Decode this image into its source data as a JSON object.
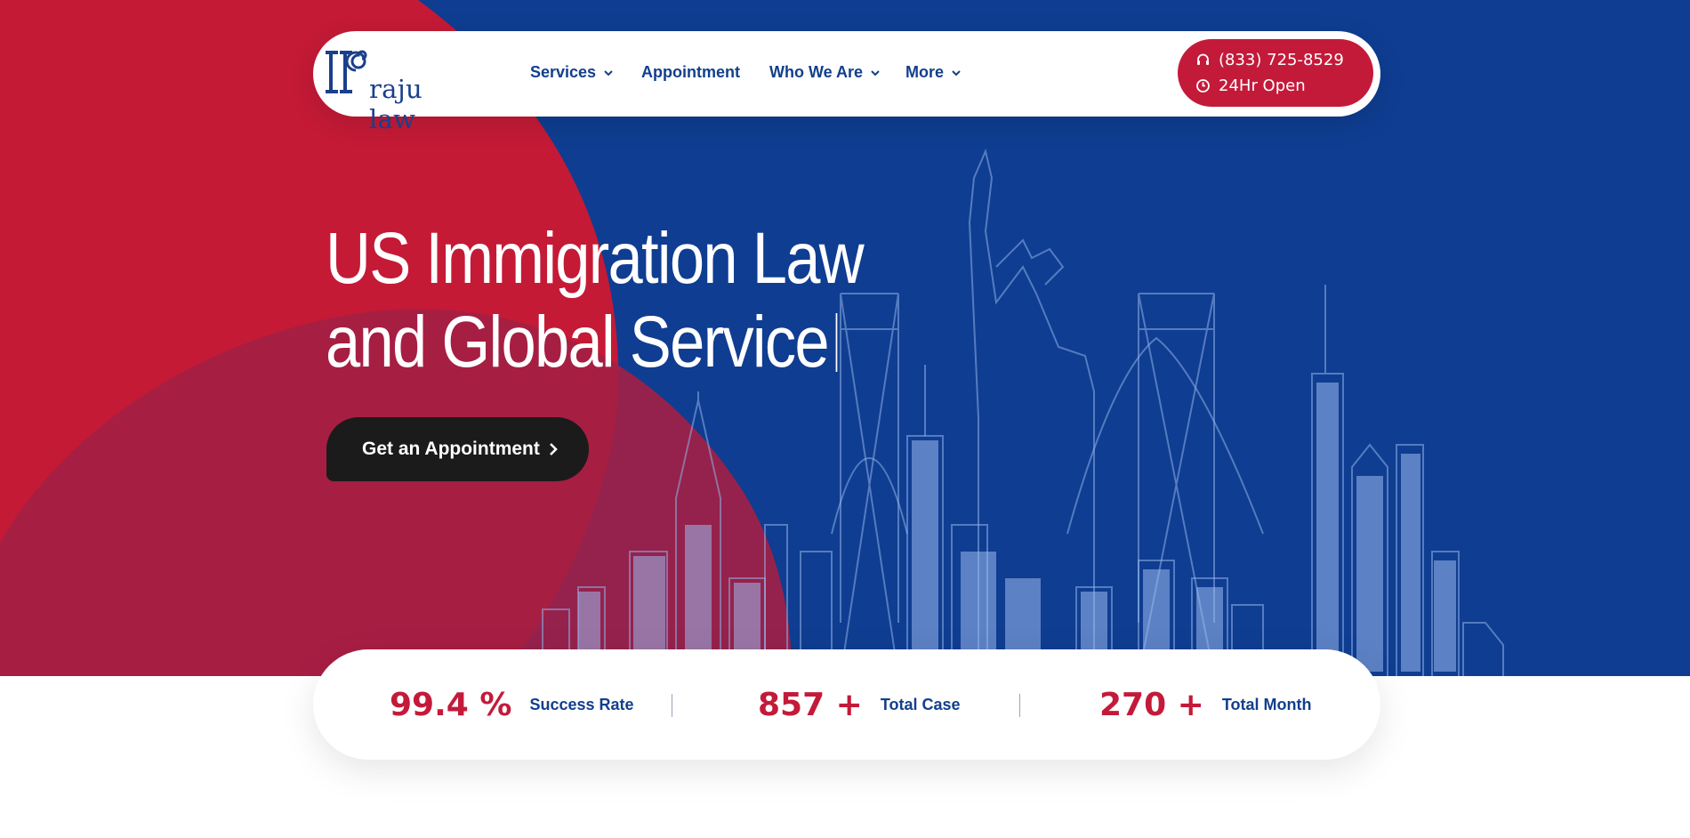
{
  "brand": {
    "name": "raju law"
  },
  "nav": [
    {
      "label": "Services",
      "dropdown": true
    },
    {
      "label": "Appointment",
      "dropdown": false
    },
    {
      "label": "Who We Are",
      "dropdown": true
    },
    {
      "label": "More",
      "dropdown": true
    }
  ],
  "contact": {
    "phone": "(833) 725-8529",
    "hours": "24Hr Open",
    "phone_icon": "headset-icon",
    "hours_icon": "clock-icon"
  },
  "hero": {
    "title_line1": "US Immigration Law",
    "title_line2": "and Global Service",
    "cta_label": "Get an Appointment"
  },
  "stats": [
    {
      "value": "99.4 %",
      "label": "Success Rate"
    },
    {
      "value": "857 +",
      "label": "Total Case"
    },
    {
      "value": "270 +",
      "label": "Total Month"
    }
  ],
  "colors": {
    "brand_red": "#c41a3a",
    "brand_blue": "#0f3d91",
    "dark": "#1b1b1b",
    "nav_text": "#123f8c"
  }
}
